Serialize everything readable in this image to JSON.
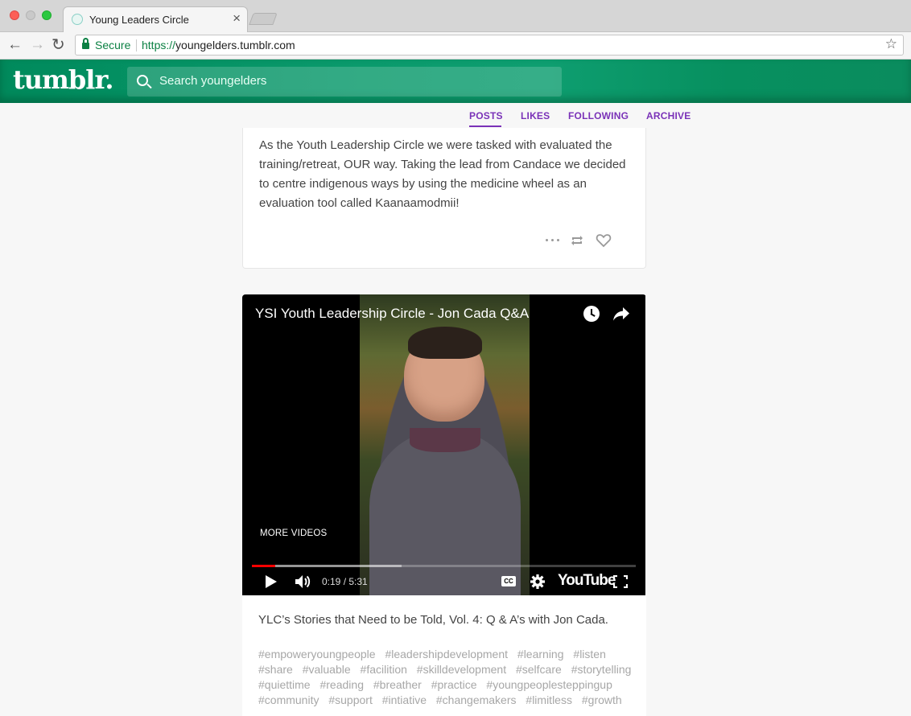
{
  "browser": {
    "tab_title": "Young Leaders Circle",
    "tab_close": "×",
    "secure_label": "Secure",
    "url_scheme": "https://",
    "url_host": "youngelders.tumblr.com"
  },
  "header": {
    "logo": "tumblr.",
    "search_placeholder": "Search youngelders",
    "brand_color": "#0a9a6c"
  },
  "blog_nav": {
    "items": [
      "POSTS",
      "LIKES",
      "FOLLOWING",
      "ARCHIVE"
    ],
    "active": "POSTS",
    "accent_color": "#7a32b8"
  },
  "post1": {
    "text": "As the Youth Leadership Circle we were tasked with evaluated the training/retreat, OUR way. Taking the lead from Candace we decided to centre indigenous ways by using the medicine wheel as an evaluation tool called Kaanaamodmii!"
  },
  "post2": {
    "video": {
      "title": "YSI Youth Leadership Circle - Jon Cada Q&A",
      "more_videos": "MORE VIDEOS",
      "time": "0:19 / 5:31",
      "played_fraction": 0.06,
      "buffered_fraction": 0.39,
      "cc_label": "CC",
      "youtube_logo": "YouTube"
    },
    "caption": "YLC’s Stories that Need to be Told, Vol. 4: Q & A’s with Jon Cada.",
    "tags": [
      "#empoweryoungpeople",
      "#leadershipdevelopment",
      "#learning",
      "#listen",
      "#share",
      "#valuable",
      "#facilition",
      "#skilldevelopment",
      "#selfcare",
      "#storytelling",
      "#quiettime",
      "#reading",
      "#breather",
      "#practice",
      "#youngpeoplesteppingup",
      "#community",
      "#support",
      "#intiative",
      "#changemakers",
      "#limitless",
      "#growth"
    ]
  }
}
